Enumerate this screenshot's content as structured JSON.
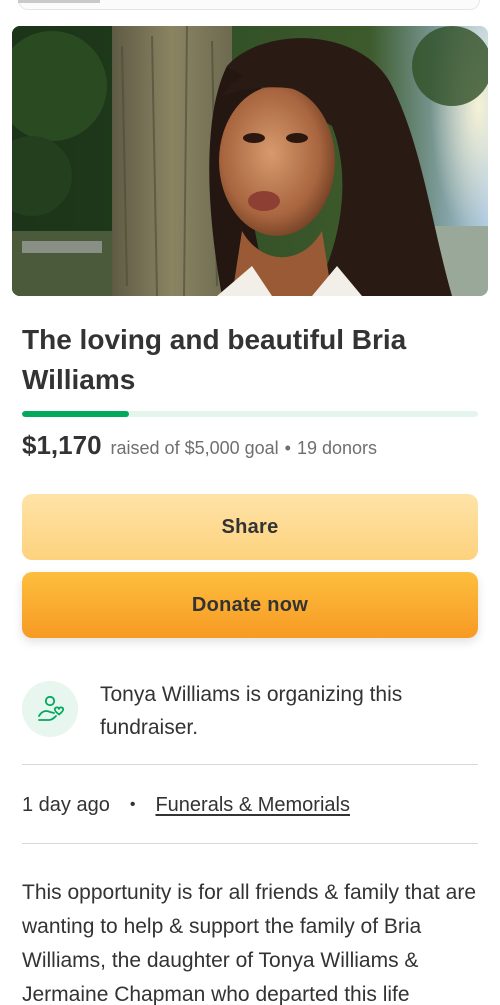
{
  "campaign": {
    "title": "The loving and beautiful Bria Williams",
    "amount_raised": "$1,170",
    "goal_text": "raised of $5,000 goal",
    "donors_text": "19 donors",
    "progress_fraction": 0.234
  },
  "actions": {
    "share_label": "Share",
    "donate_label": "Donate now"
  },
  "organizer": {
    "text": "Tonya Williams is organizing this fundraiser.",
    "icon": "heart-hand-icon"
  },
  "meta": {
    "posted": "1 day ago",
    "category": "Funerals & Memorials"
  },
  "story": {
    "text": "This opportunity is for all friends & family that are wanting to help & support the family of Bria Williams, the daughter of Tonya Williams & Jermaine Chapman who departed this life"
  },
  "colors": {
    "progress_fill": "#02a95c",
    "progress_track": "#e4f5ee",
    "share_bg": "#fdd27d",
    "donate_bg": "#f8a52e",
    "organizer_icon_bg": "#e7f6ee",
    "organizer_icon_stroke": "#02a95c"
  }
}
